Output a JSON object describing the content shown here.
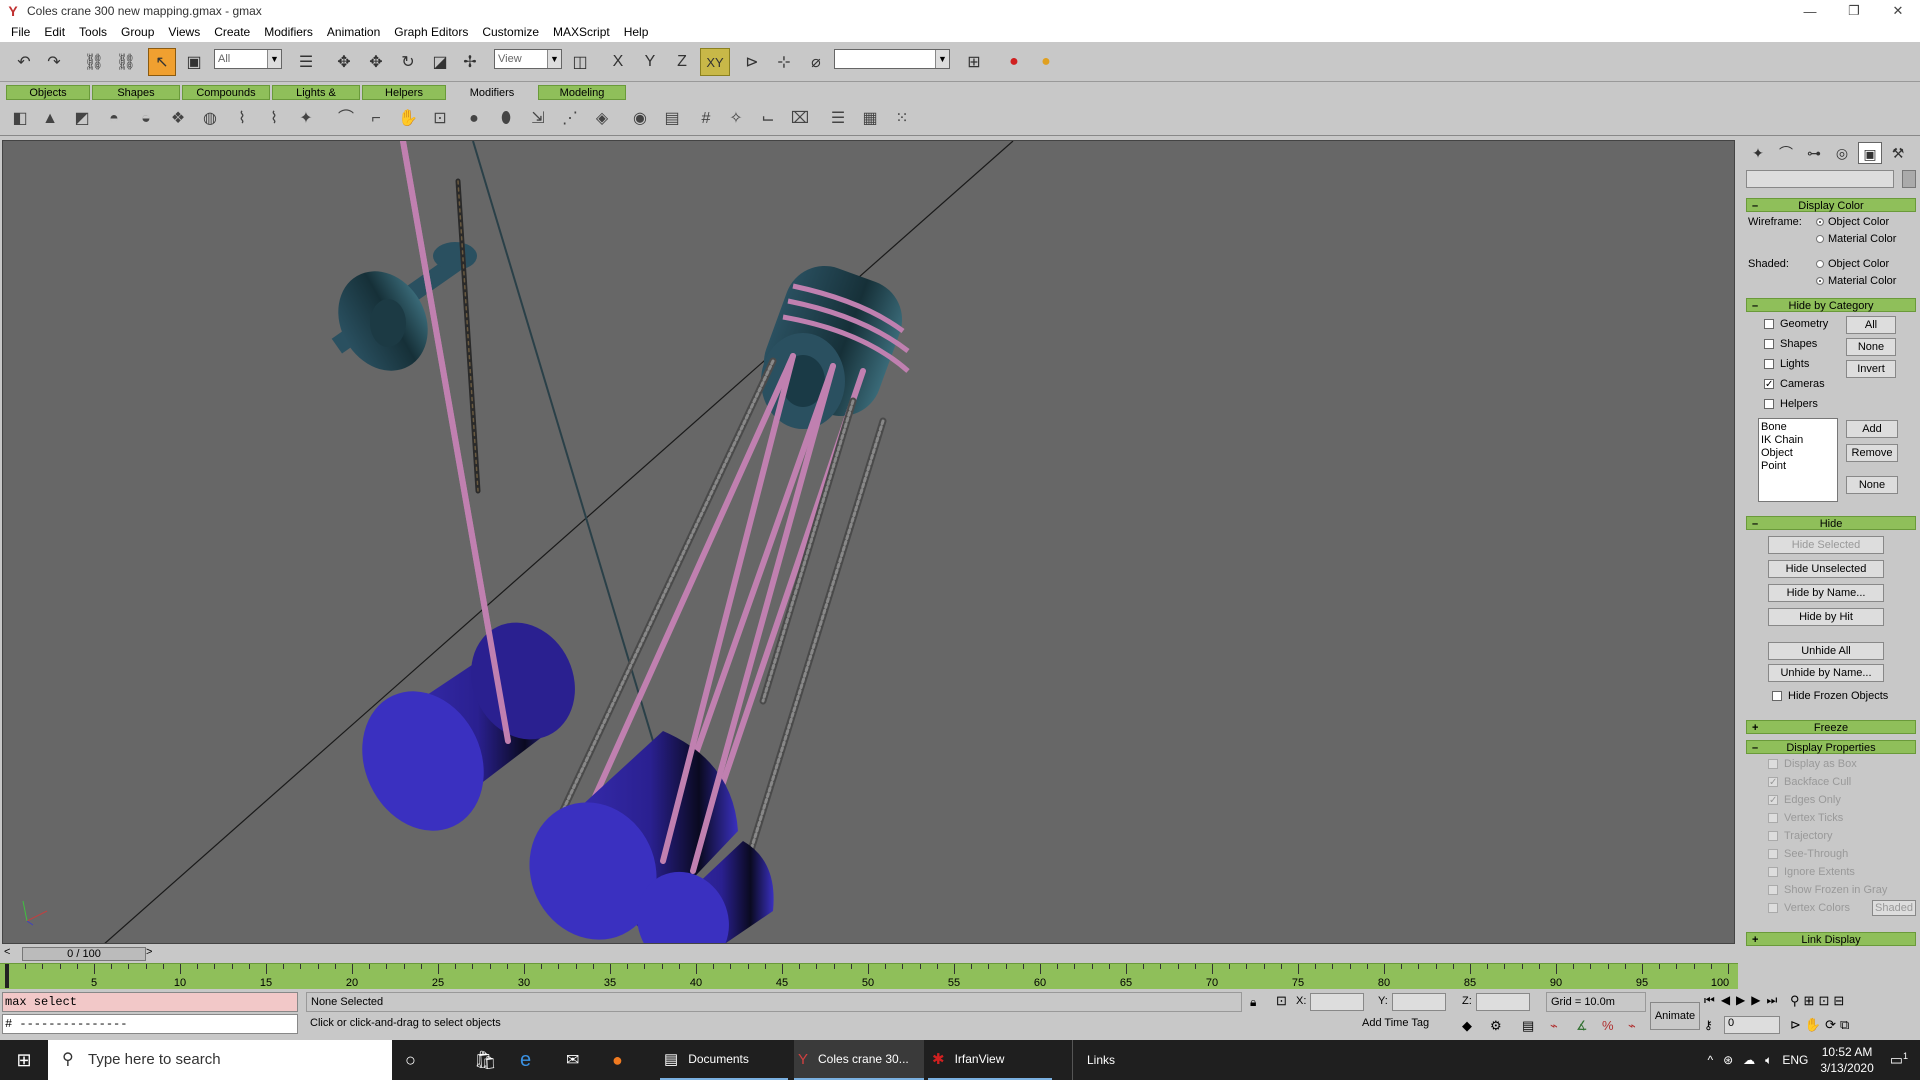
{
  "window": {
    "title": "Coles crane 300 new mapping.gmax - gmax",
    "min": "—",
    "max": "❐",
    "close": "✕"
  },
  "menu": [
    "File",
    "Edit",
    "Tools",
    "Group",
    "Views",
    "Create",
    "Modifiers",
    "Animation",
    "Graph Editors",
    "Customize",
    "MAXScript",
    "Help"
  ],
  "toolbar": {
    "filter_value": "All",
    "coord_value": "View",
    "named_sel": "",
    "axis": [
      "X",
      "Y",
      "Z",
      "XY"
    ]
  },
  "tabs": [
    "Objects",
    "Shapes",
    "Compounds",
    "Lights & Cameras",
    "Helpers",
    "Modifiers",
    "Modeling"
  ],
  "command_panel": {
    "display_color": {
      "title": "Display Color",
      "wireframe_label": "Wireframe:",
      "shaded_label": "Shaded:",
      "opt_object": "Object Color",
      "opt_material": "Material Color"
    },
    "hide_by_category": {
      "title": "Hide by Category",
      "items": [
        {
          "label": "Geometry",
          "checked": false
        },
        {
          "label": "Shapes",
          "checked": false
        },
        {
          "label": "Lights",
          "checked": false
        },
        {
          "label": "Cameras",
          "checked": true
        },
        {
          "label": "Helpers",
          "checked": false
        }
      ],
      "btn_all": "All",
      "btn_none": "None",
      "btn_invert": "Invert",
      "list": [
        "Bone",
        "IK Chain Object",
        "Point"
      ],
      "btn_add": "Add",
      "btn_remove": "Remove",
      "btn_none2": "None"
    },
    "hide": {
      "title": "Hide",
      "buttons": [
        "Hide Selected",
        "Hide Unselected",
        "Hide by Name...",
        "Hide by Hit",
        "Unhide All",
        "Unhide by Name..."
      ],
      "frozen": "Hide Frozen Objects"
    },
    "freeze": {
      "title": "Freeze"
    },
    "display_properties": {
      "title": "Display Properties",
      "items": [
        {
          "label": "Display as Box",
          "checked": false
        },
        {
          "label": "Backface Cull",
          "checked": true
        },
        {
          "label": "Edges Only",
          "checked": true
        },
        {
          "label": "Vertex Ticks",
          "checked": false
        },
        {
          "label": "Trajectory",
          "checked": false
        },
        {
          "label": "See-Through",
          "checked": false
        },
        {
          "label": "Ignore Extents",
          "checked": false
        },
        {
          "label": "Show Frozen in Gray",
          "checked": false
        },
        {
          "label": "Vertex Colors",
          "checked": false
        }
      ],
      "shaded_btn": "Shaded"
    },
    "link_display": {
      "title": "Link Display"
    }
  },
  "timeline": {
    "slider": "0 / 100",
    "ticks": [
      "5",
      "10",
      "15",
      "20",
      "25",
      "30",
      "35",
      "40",
      "45",
      "50",
      "55",
      "60",
      "65",
      "70",
      "75",
      "80",
      "85",
      "90",
      "95",
      "100"
    ]
  },
  "status": {
    "listener1": "max select",
    "listener2": "# ---------------",
    "selection": "None Selected",
    "prompt": "Click or click-and-drag to select objects",
    "x_label": "X:",
    "y_label": "Y:",
    "z_label": "Z:",
    "grid": "Grid = 10.0m",
    "add_time_tag": "Add Time Tag",
    "animate": "Animate",
    "frame": "0"
  },
  "taskbar": {
    "search_placeholder": "Type here to search",
    "apps": [
      "Documents",
      "Coles crane 30...",
      "IrfanView",
      "Links"
    ],
    "lang": "ENG",
    "time": "10:52 AM",
    "date": "3/13/2020",
    "notif": "1"
  },
  "colors": {
    "accent_green": "#8fbf5a",
    "viewport": "#676767",
    "drum": "#3a2fb8",
    "rope_pink": "#c080b0"
  }
}
